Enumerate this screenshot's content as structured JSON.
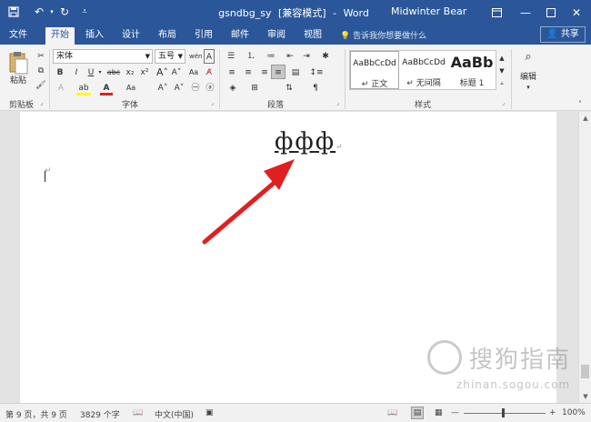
{
  "titlebar": {
    "doc_name": "gsndbg_sy",
    "mode": "[兼容模式]",
    "separator": "-",
    "app": "Word",
    "user": "Midwinter Bear"
  },
  "tabs": [
    "文件",
    "开始",
    "插入",
    "设计",
    "布局",
    "引用",
    "邮件",
    "审阅",
    "视图"
  ],
  "tellme_placeholder": "告诉我你想要做什么",
  "share_label": "共享",
  "ribbon": {
    "clipboard": {
      "paste_label": "粘贴",
      "group_label": "剪贴板"
    },
    "font": {
      "font_name": "宋体",
      "font_size": "五号",
      "bold": "B",
      "italic": "I",
      "underline": "U",
      "strike": "abc",
      "subscript": "x₂",
      "superscript": "x²",
      "group_label": "字体"
    },
    "paragraph": {
      "group_label": "段落"
    },
    "styles": {
      "items": [
        {
          "sample": "AaBbCcDd",
          "name": "↵ 正文"
        },
        {
          "sample": "AaBbCcDd",
          "name": "↵ 无间隔"
        },
        {
          "sample": "AaBb",
          "name": "标题 1"
        }
      ],
      "group_label": "样式"
    },
    "editing": {
      "label": "编辑"
    }
  },
  "document": {
    "text": "Φ̲Φ̲Φ̲",
    "chars": [
      "ф",
      "ф",
      "ф"
    ]
  },
  "statusbar": {
    "page": "第 9 页，共 9 页",
    "words": "3829 个字",
    "language": "中文(中国)",
    "zoom": "100%"
  },
  "watermark": {
    "main": "搜狗指南",
    "sub": "zhinan.sogou.com"
  },
  "colors": {
    "titlebar": "#2b579a",
    "arrow": "#e02020"
  }
}
